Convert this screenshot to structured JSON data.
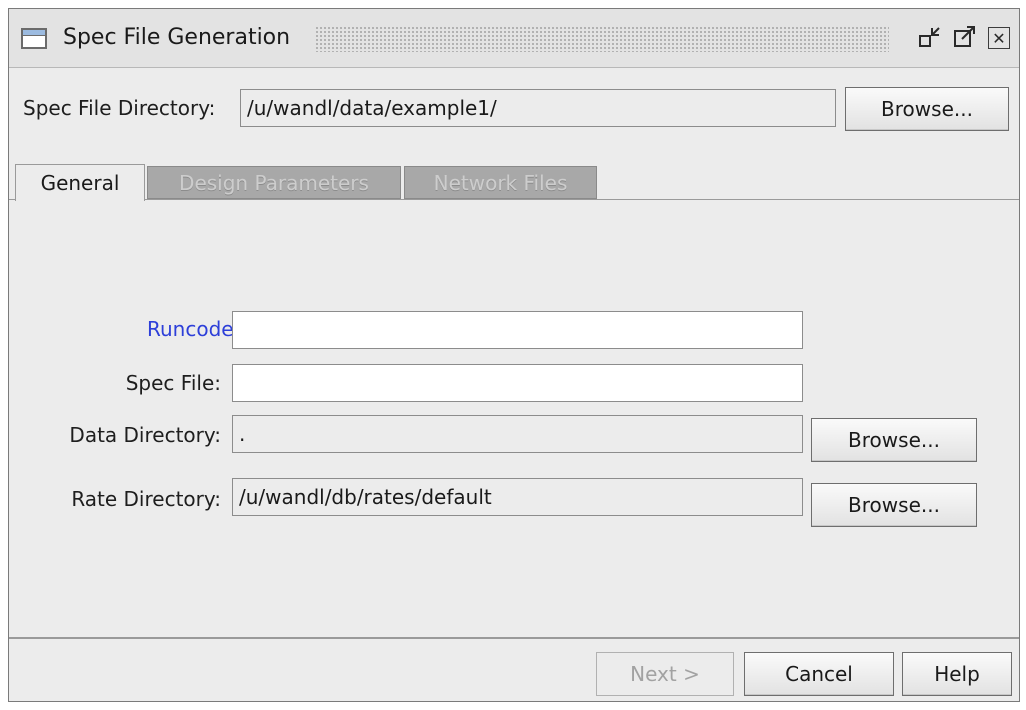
{
  "window": {
    "title": "Spec File Generation",
    "title_icon": "window-icon",
    "controls": [
      "minimize-icon",
      "maximize-icon",
      "close-icon"
    ]
  },
  "spec_dir": {
    "label": "Spec File Directory:",
    "value": "/u/wandl/data/example1/",
    "browse_label": "Browse..."
  },
  "tabs": [
    {
      "label": "General",
      "active": true
    },
    {
      "label": "Design Parameters",
      "active": false
    },
    {
      "label": "Network Files",
      "active": false
    }
  ],
  "general": {
    "runcode": {
      "label": "Runcode:",
      "value": ""
    },
    "spec_file": {
      "label": "Spec File:",
      "value": ""
    },
    "data_dir": {
      "label": "Data Directory:",
      "value": ".",
      "browse_label": "Browse..."
    },
    "rate_dir": {
      "label": "Rate Directory:",
      "value": "/u/wandl/db/rates/default",
      "browse_label": "Browse..."
    }
  },
  "footer": {
    "next_label": "Next >",
    "cancel_label": "Cancel",
    "help_label": "Help"
  },
  "colors": {
    "runcode_label": "#2d3fd9",
    "panel": "#ececec",
    "inactive_tab": "#a8a8a8"
  }
}
